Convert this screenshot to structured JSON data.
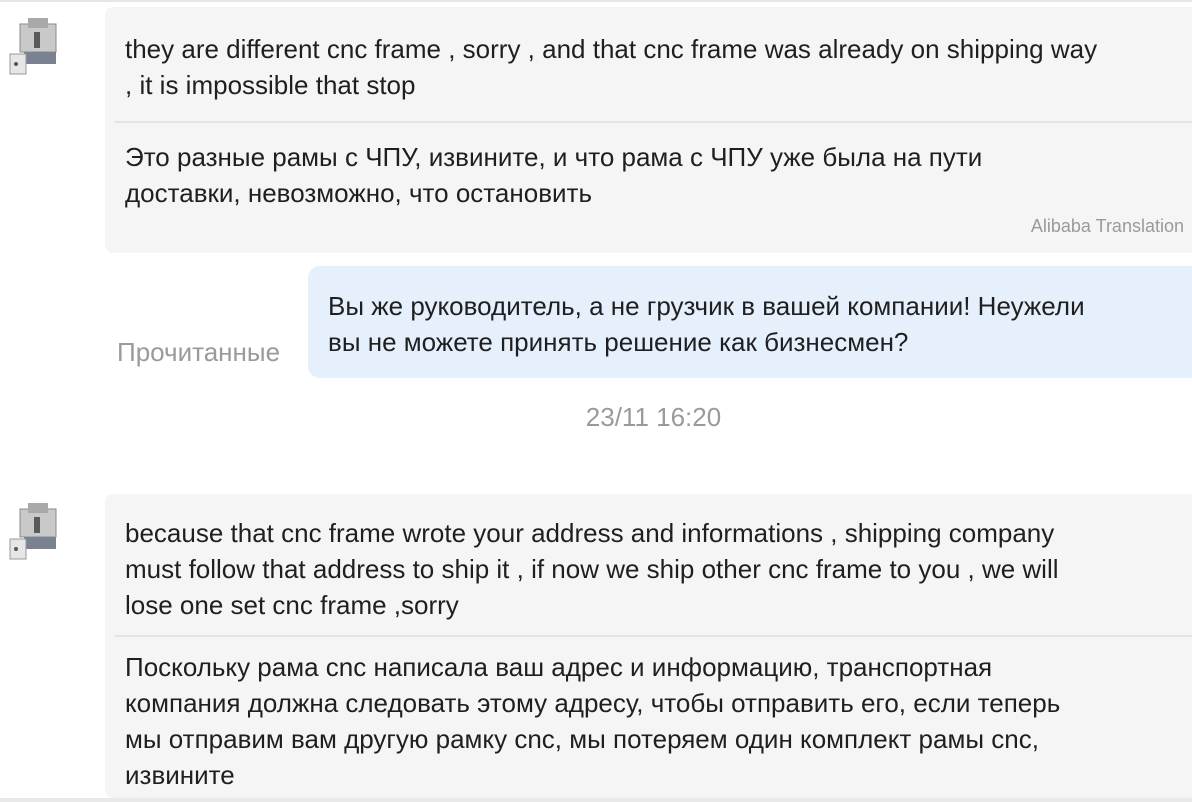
{
  "messages": [
    {
      "original": "they are different cnc frame , sorry , and that cnc frame was already on shipping way , it is impossible that stop",
      "original_lines": [
        "they are different cnc frame , sorry , and that cnc frame was already on shipping way",
        ", it is impossible that stop"
      ],
      "translation_lines": [
        "Это разные рамы с ЧПУ, извините, и что рама с ЧПУ уже была на пути",
        "доставки, невозможно, что остановить"
      ],
      "translation_credit": "Alibaba Translation"
    },
    {
      "original_lines": [
        "because that cnc frame wrote your address and informations , shipping company",
        "must follow that address to ship it , if now we ship other cnc frame to you , we will",
        "lose one set cnc frame ,sorry"
      ],
      "translation_lines": [
        "Поскольку рама cnc написала ваш адрес и информацию, транспортная",
        "компания должна следовать этому адресу, чтобы отправить его, если теперь",
        "мы отправим вам другую рамку cnc, мы потеряем один комплект рамы cnc,",
        "извините"
      ]
    }
  ],
  "outgoing": {
    "lines": [
      "Вы же руководитель, а не грузчик в вашей компании! Неужели",
      "вы не можете принять решение как бизнесмен?"
    ],
    "status": "Прочитанные"
  },
  "timestamp": "23/11 16:20",
  "colors": {
    "incoming_bg": "#f5f5f5",
    "outgoing_bg": "#e6f0fd",
    "muted_text": "#9a9a9a"
  },
  "icons": {
    "avatar": "cnc-machine-avatar-icon"
  }
}
